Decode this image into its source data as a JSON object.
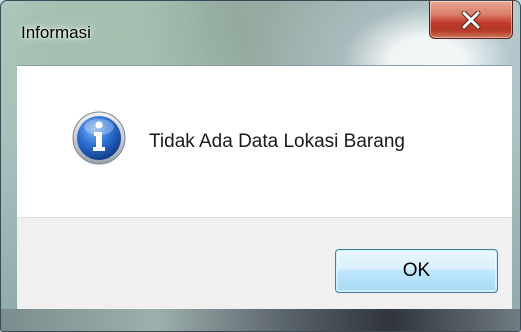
{
  "window": {
    "title": "Informasi",
    "close_icon": "close-icon",
    "colors": {
      "close_button": "#c0392b",
      "ok_border": "#3c7fb1",
      "body_bg": "#ffffff",
      "footer_bg": "#f0f0f0"
    }
  },
  "message": {
    "icon": "info-icon",
    "text": "Tidak Ada Data Lokasi Barang"
  },
  "buttons": {
    "ok_label": "OK"
  }
}
